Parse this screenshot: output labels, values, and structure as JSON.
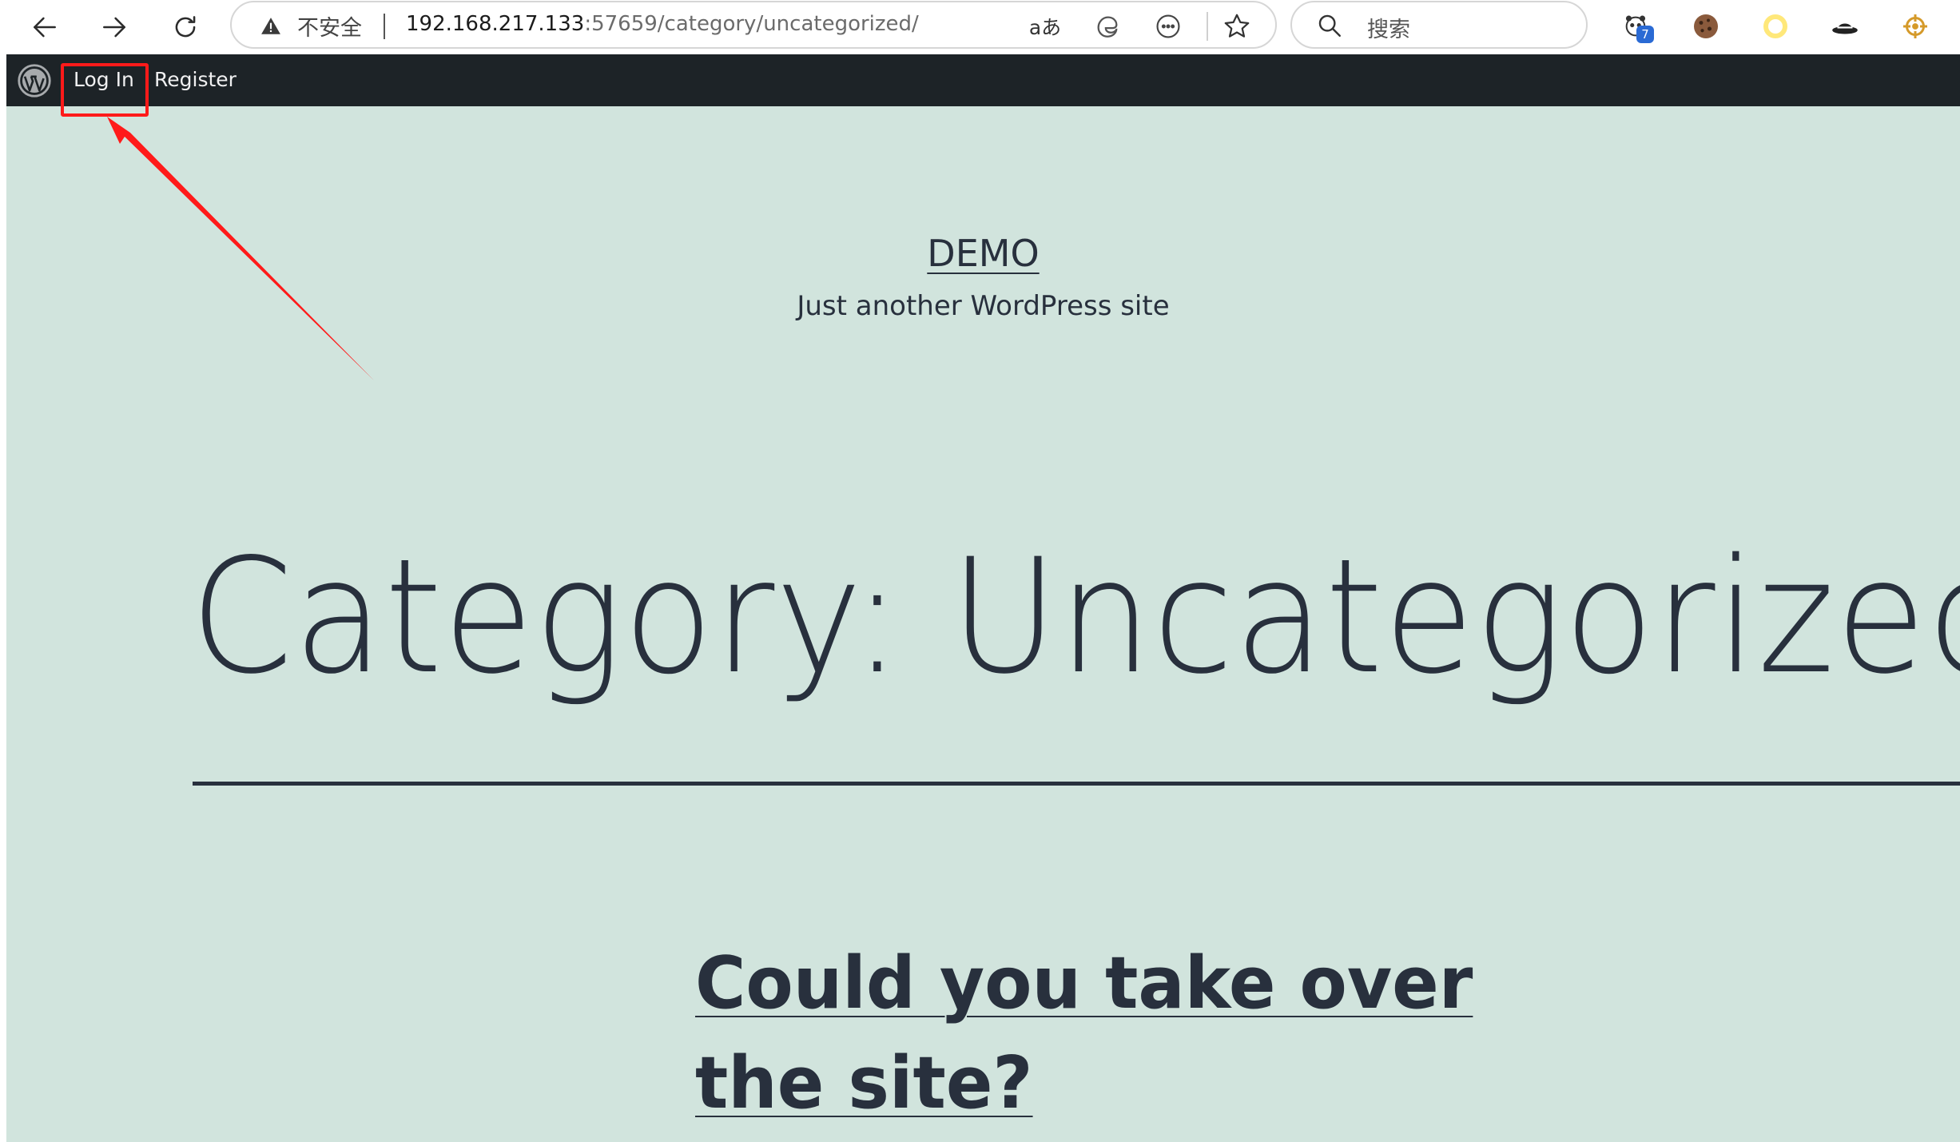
{
  "browser": {
    "security_label": "不安全",
    "url_host": "192.168.217.133",
    "url_rest": ":57659/category/uncategorized/",
    "search_placeholder": "搜索",
    "translate_label": "aあ",
    "extension_badge": "7"
  },
  "admin_bar": {
    "login_label": "Log In",
    "register_label": "Register"
  },
  "site": {
    "title": "DEMO",
    "tagline": "Just another WordPress site"
  },
  "archive": {
    "title": "Category: Uncategorized"
  },
  "post": {
    "title": "Could you take over the site?"
  },
  "colors": {
    "page_background": "#d1e4dd",
    "admin_bar": "#1d2327",
    "text": "#28303d",
    "annotation": "#ff1a1a"
  }
}
